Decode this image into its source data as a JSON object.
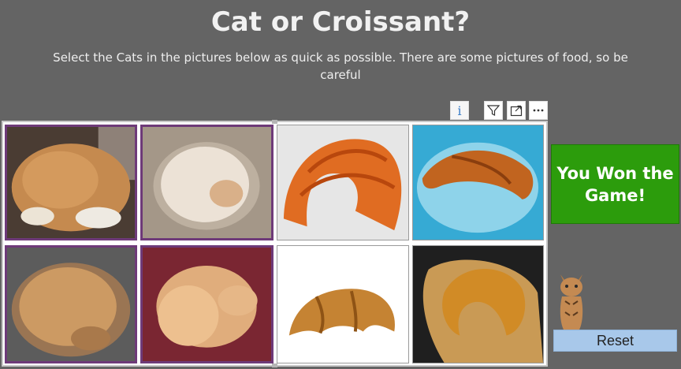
{
  "page": {
    "title": "Cat or Croissant?",
    "subtitle": "Select the Cats in the pictures below as quick as possible. There are some pictures of food, so be careful"
  },
  "visual_header": {
    "info_label": "i",
    "icons": [
      "info-icon",
      "filter-icon",
      "focus-mode-icon",
      "more-options-icon"
    ]
  },
  "grid": {
    "selection_color": "#6e3a79",
    "tiles": [
      {
        "subject": "cat",
        "selected": true
      },
      {
        "subject": "cat",
        "selected": true
      },
      {
        "subject": "croissant",
        "selected": false
      },
      {
        "subject": "croissant",
        "selected": false
      },
      {
        "subject": "cat",
        "selected": true
      },
      {
        "subject": "cat",
        "selected": true
      },
      {
        "subject": "croissant",
        "selected": false
      },
      {
        "subject": "croissant",
        "selected": false
      }
    ]
  },
  "result": {
    "message": "You Won the Game!",
    "color": "#2c9c0c"
  },
  "reset_button": {
    "label": "Reset",
    "color": "#a8c8ea"
  }
}
